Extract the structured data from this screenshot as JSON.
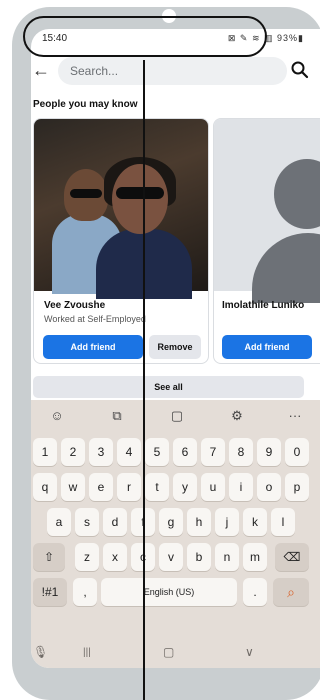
{
  "status": {
    "time": "15:40",
    "icons": "⊠ ✎ ≋ ▥ 93%▮"
  },
  "search": {
    "placeholder": "Search..."
  },
  "section": {
    "title": "People you may know"
  },
  "cards": [
    {
      "name": "Vee Zvoushe",
      "subtitle": "Worked at Self-Employed",
      "add_label": "Add friend",
      "remove_label": "Remove"
    },
    {
      "name": "Imolathile Luniko",
      "add_label": "Add friend"
    }
  ],
  "see_all": "See all",
  "keyboard": {
    "toolbar": [
      "☺",
      "⧉",
      "▢",
      "⚙",
      "···"
    ],
    "row_numbers": [
      "1",
      "2",
      "3",
      "4",
      "5",
      "6",
      "7",
      "8",
      "9",
      "0"
    ],
    "row_q": [
      "q",
      "w",
      "e",
      "r",
      "t",
      "y",
      "u",
      "i",
      "o",
      "p"
    ],
    "row_a": [
      "a",
      "s",
      "d",
      "f",
      "g",
      "h",
      "j",
      "k",
      "l"
    ],
    "row_z": [
      "z",
      "x",
      "c",
      "v",
      "b",
      "n",
      "m"
    ],
    "shift": "⇧",
    "backspace": "⌫",
    "symbols": "!#1",
    "comma": ",",
    "space": "English (US)",
    "period": ".",
    "search_key": "⌕"
  },
  "nav": {
    "mic": "🎙",
    "recents": "|||",
    "home": "▢",
    "back": "∨"
  },
  "colors": {
    "accent": "#1b74e4",
    "keyboard_bg": "#e4ddd7"
  }
}
